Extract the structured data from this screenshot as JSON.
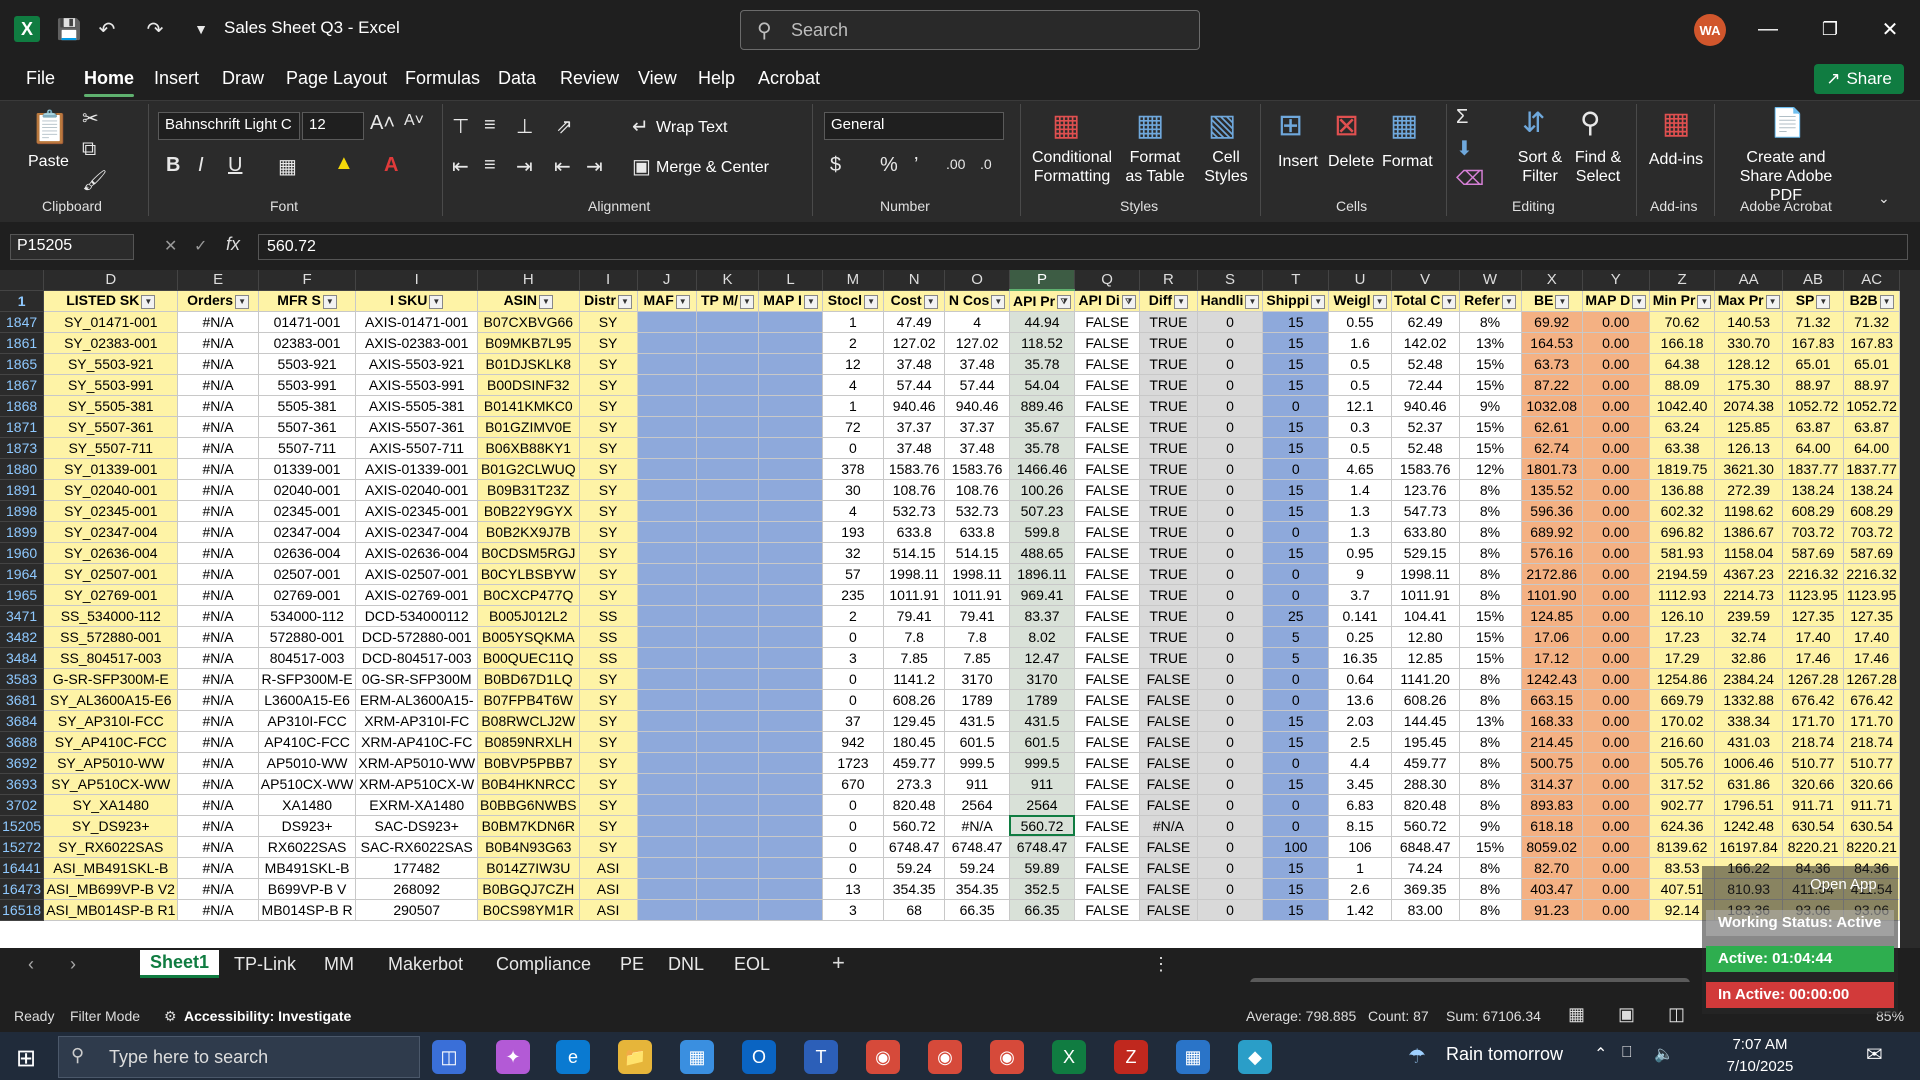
{
  "titlebar": {
    "title": "Sales Sheet Q3 - Excel",
    "search_placeholder": "Search",
    "avatar": "WA"
  },
  "menus": [
    "File",
    "Home",
    "Insert",
    "Draw",
    "Page Layout",
    "Formulas",
    "Data",
    "Review",
    "View",
    "Help",
    "Acrobat"
  ],
  "share_label": "Share",
  "ribbon": {
    "paste": "Paste",
    "clipboard": "Clipboard",
    "font_name": "Bahnschrift Light C",
    "font_size": "12",
    "font": "Font",
    "wrap_text": "Wrap Text",
    "merge_center": "Merge & Center",
    "alignment": "Alignment",
    "number_format": "General",
    "number": "Number",
    "conditional": "Conditional Formatting",
    "format_table": "Format as Table",
    "cell_styles": "Cell Styles",
    "styles": "Styles",
    "insert": "Insert",
    "delete": "Delete",
    "format": "Format",
    "cells": "Cells",
    "sort_filter": "Sort & Filter",
    "find_select": "Find & Select",
    "editing": "Editing",
    "addins": "Add-ins",
    "addins_group": "Add-ins",
    "create_share": "Create and Share Adobe PDF",
    "adobe": "Adobe Acrobat"
  },
  "formula": {
    "namebox": "P15205",
    "value": "560.72"
  },
  "columns": [
    "D",
    "E",
    "F",
    "I",
    "H",
    "I",
    "J",
    "K",
    "L",
    "M",
    "N",
    "O",
    "P",
    "Q",
    "R",
    "S",
    "T",
    "U",
    "V",
    "W",
    "X",
    "Y",
    "Z",
    "AA",
    "AB",
    "AC"
  ],
  "headers": [
    "LISTED SK",
    "Orders",
    "MFR S",
    "I SKU",
    "ASIN",
    "Distr",
    "MAF",
    "TP M/",
    "MAP I",
    "Stocl",
    "Cost",
    "N Cos",
    "API Pr",
    "API Di",
    "Diff",
    "Handli",
    "Shippi",
    "Weigl",
    "Total C",
    "Refer",
    "BE",
    "MAP D",
    "Min Pr",
    "Max Pr",
    "SP",
    "B2B"
  ],
  "rows": [
    [
      "1847",
      "SY_01471-001",
      "#N/A",
      "01471-001",
      "AXIS-01471-001",
      "B07CXBVG66",
      "SY",
      "",
      "",
      "",
      "1",
      "47.49",
      "4",
      "44.94",
      "FALSE",
      "TRUE",
      "0",
      "15",
      "0.55",
      "62.49",
      "8%",
      "69.92",
      "0.00",
      "70.62",
      "140.53",
      "71.32",
      "71.32"
    ],
    [
      "1861",
      "SY_02383-001",
      "#N/A",
      "02383-001",
      "AXIS-02383-001",
      "B09MKB7L95",
      "SY",
      "",
      "",
      "",
      "2",
      "127.02",
      "127.02",
      "118.52",
      "FALSE",
      "TRUE",
      "0",
      "15",
      "1.6",
      "142.02",
      "13%",
      "164.53",
      "0.00",
      "166.18",
      "330.70",
      "167.83",
      "167.83"
    ],
    [
      "1865",
      "SY_5503-921",
      "#N/A",
      "5503-921",
      "AXIS-5503-921",
      "B01DJSKLK8",
      "SY",
      "",
      "",
      "",
      "12",
      "37.48",
      "37.48",
      "35.78",
      "FALSE",
      "TRUE",
      "0",
      "15",
      "0.5",
      "52.48",
      "15%",
      "63.73",
      "0.00",
      "64.38",
      "128.12",
      "65.01",
      "65.01"
    ],
    [
      "1867",
      "SY_5503-991",
      "#N/A",
      "5503-991",
      "AXIS-5503-991",
      "B00DSINF32",
      "SY",
      "",
      "",
      "",
      "4",
      "57.44",
      "57.44",
      "54.04",
      "FALSE",
      "TRUE",
      "0",
      "15",
      "0.5",
      "72.44",
      "15%",
      "87.22",
      "0.00",
      "88.09",
      "175.30",
      "88.97",
      "88.97"
    ],
    [
      "1868",
      "SY_5505-381",
      "#N/A",
      "5505-381",
      "AXIS-5505-381",
      "B0141KMKC0",
      "SY",
      "",
      "",
      "",
      "1",
      "940.46",
      "940.46",
      "889.46",
      "FALSE",
      "TRUE",
      "0",
      "0",
      "12.1",
      "940.46",
      "9%",
      "1032.08",
      "0.00",
      "1042.40",
      "2074.38",
      "1052.72",
      "1052.72"
    ],
    [
      "1871",
      "SY_5507-361",
      "#N/A",
      "5507-361",
      "AXIS-5507-361",
      "B01GZIMV0E",
      "SY",
      "",
      "",
      "",
      "72",
      "37.37",
      "37.37",
      "35.67",
      "FALSE",
      "TRUE",
      "0",
      "15",
      "0.3",
      "52.37",
      "15%",
      "62.61",
      "0.00",
      "63.24",
      "125.85",
      "63.87",
      "63.87"
    ],
    [
      "1873",
      "SY_5507-711",
      "#N/A",
      "5507-711",
      "AXIS-5507-711",
      "B06XB88KY1",
      "SY",
      "",
      "",
      "",
      "0",
      "37.48",
      "37.48",
      "35.78",
      "FALSE",
      "TRUE",
      "0",
      "15",
      "0.5",
      "52.48",
      "15%",
      "62.74",
      "0.00",
      "63.38",
      "126.13",
      "64.00",
      "64.00"
    ],
    [
      "1880",
      "SY_01339-001",
      "#N/A",
      "01339-001",
      "AXIS-01339-001",
      "B01G2CLWUQ",
      "SY",
      "",
      "",
      "",
      "378",
      "1583.76",
      "1583.76",
      "1466.46",
      "FALSE",
      "TRUE",
      "0",
      "0",
      "4.65",
      "1583.76",
      "12%",
      "1801.73",
      "0.00",
      "1819.75",
      "3621.30",
      "1837.77",
      "1837.77"
    ],
    [
      "1891",
      "SY_02040-001",
      "#N/A",
      "02040-001",
      "AXIS-02040-001",
      "B09B31T23Z",
      "SY",
      "",
      "",
      "",
      "30",
      "108.76",
      "108.76",
      "100.26",
      "FALSE",
      "TRUE",
      "0",
      "15",
      "1.4",
      "123.76",
      "8%",
      "135.52",
      "0.00",
      "136.88",
      "272.39",
      "138.24",
      "138.24"
    ],
    [
      "1898",
      "SY_02345-001",
      "#N/A",
      "02345-001",
      "AXIS-02345-001",
      "B0B22Y9GYX",
      "SY",
      "",
      "",
      "",
      "4",
      "532.73",
      "532.73",
      "507.23",
      "FALSE",
      "TRUE",
      "0",
      "15",
      "1.3",
      "547.73",
      "8%",
      "596.36",
      "0.00",
      "602.32",
      "1198.62",
      "608.29",
      "608.29"
    ],
    [
      "1899",
      "SY_02347-004",
      "#N/A",
      "02347-004",
      "AXIS-02347-004",
      "B0B2KX9J7B",
      "SY",
      "",
      "",
      "",
      "193",
      "633.8",
      "633.8",
      "599.8",
      "FALSE",
      "TRUE",
      "0",
      "0",
      "1.3",
      "633.80",
      "8%",
      "689.92",
      "0.00",
      "696.82",
      "1386.67",
      "703.72",
      "703.72"
    ],
    [
      "1960",
      "SY_02636-004",
      "#N/A",
      "02636-004",
      "AXIS-02636-004",
      "B0CDSM5RGJ",
      "SY",
      "",
      "",
      "",
      "32",
      "514.15",
      "514.15",
      "488.65",
      "FALSE",
      "TRUE",
      "0",
      "15",
      "0.95",
      "529.15",
      "8%",
      "576.16",
      "0.00",
      "581.93",
      "1158.04",
      "587.69",
      "587.69"
    ],
    [
      "1964",
      "SY_02507-001",
      "#N/A",
      "02507-001",
      "AXIS-02507-001",
      "B0CYLBSBYW",
      "SY",
      "",
      "",
      "",
      "57",
      "1998.11",
      "1998.11",
      "1896.11",
      "FALSE",
      "TRUE",
      "0",
      "0",
      "9",
      "1998.11",
      "8%",
      "2172.86",
      "0.00",
      "2194.59",
      "4367.23",
      "2216.32",
      "2216.32"
    ],
    [
      "1965",
      "SY_02769-001",
      "#N/A",
      "02769-001",
      "AXIS-02769-001",
      "B0CXCP477Q",
      "SY",
      "",
      "",
      "",
      "235",
      "1011.91",
      "1011.91",
      "969.41",
      "FALSE",
      "TRUE",
      "0",
      "0",
      "3.7",
      "1011.91",
      "8%",
      "1101.90",
      "0.00",
      "1112.93",
      "2214.73",
      "1123.95",
      "1123.95"
    ],
    [
      "3471",
      "SS_534000-112",
      "#N/A",
      "534000-112",
      "DCD-534000112",
      "B005J012L2",
      "SS",
      "",
      "",
      "",
      "2",
      "79.41",
      "79.41",
      "83.37",
      "FALSE",
      "TRUE",
      "0",
      "25",
      "0.141",
      "104.41",
      "15%",
      "124.85",
      "0.00",
      "126.10",
      "239.59",
      "127.35",
      "127.35"
    ],
    [
      "3482",
      "SS_572880-001",
      "#N/A",
      "572880-001",
      "DCD-572880-001",
      "B005YSQKMA",
      "SS",
      "",
      "",
      "",
      "0",
      "7.8",
      "7.8",
      "8.02",
      "FALSE",
      "TRUE",
      "0",
      "5",
      "0.25",
      "12.80",
      "15%",
      "17.06",
      "0.00",
      "17.23",
      "32.74",
      "17.40",
      "17.40"
    ],
    [
      "3484",
      "SS_804517-003",
      "#N/A",
      "804517-003",
      "DCD-804517-003",
      "B00QUEC11Q",
      "SS",
      "",
      "",
      "",
      "3",
      "7.85",
      "7.85",
      "12.47",
      "FALSE",
      "TRUE",
      "0",
      "5",
      "16.35",
      "12.85",
      "15%",
      "17.12",
      "0.00",
      "17.29",
      "32.86",
      "17.46",
      "17.46"
    ],
    [
      "3583",
      "G-SR-SFP300M-E",
      "#N/A",
      "R-SFP300M-E",
      "0G-SR-SFP300M",
      "B0BD67D1LQ",
      "SY",
      "",
      "",
      "",
      "0",
      "1141.2",
      "3170",
      "3170",
      "FALSE",
      "FALSE",
      "0",
      "0",
      "0.64",
      "1141.20",
      "8%",
      "1242.43",
      "0.00",
      "1254.86",
      "2384.24",
      "1267.28",
      "1267.28"
    ],
    [
      "3681",
      "SY_AL3600A15-E6",
      "#N/A",
      "L3600A15-E6",
      "ERM-AL3600A15-",
      "B07FPB4T6W",
      "SY",
      "",
      "",
      "",
      "0",
      "608.26",
      "1789",
      "1789",
      "FALSE",
      "FALSE",
      "0",
      "0",
      "13.6",
      "608.26",
      "8%",
      "663.15",
      "0.00",
      "669.79",
      "1332.88",
      "676.42",
      "676.42"
    ],
    [
      "3684",
      "SY_AP310I-FCC",
      "#N/A",
      "AP310I-FCC",
      "XRM-AP310I-FC",
      "B08RWCLJ2W",
      "SY",
      "",
      "",
      "",
      "37",
      "129.45",
      "431.5",
      "431.5",
      "FALSE",
      "FALSE",
      "0",
      "15",
      "2.03",
      "144.45",
      "13%",
      "168.33",
      "0.00",
      "170.02",
      "338.34",
      "171.70",
      "171.70"
    ],
    [
      "3688",
      "SY_AP410C-FCC",
      "#N/A",
      "AP410C-FCC",
      "XRM-AP410C-FC",
      "B0859NRXLH",
      "SY",
      "",
      "",
      "",
      "942",
      "180.45",
      "601.5",
      "601.5",
      "FALSE",
      "FALSE",
      "0",
      "15",
      "2.5",
      "195.45",
      "8%",
      "214.45",
      "0.00",
      "216.60",
      "431.03",
      "218.74",
      "218.74"
    ],
    [
      "3692",
      "SY_AP5010-WW",
      "#N/A",
      "AP5010-WW",
      "XRM-AP5010-WW",
      "B0BVP5PBB7",
      "SY",
      "",
      "",
      "",
      "1723",
      "459.77",
      "999.5",
      "999.5",
      "FALSE",
      "FALSE",
      "0",
      "0",
      "4.4",
      "459.77",
      "8%",
      "500.75",
      "0.00",
      "505.76",
      "1006.46",
      "510.77",
      "510.77"
    ],
    [
      "3693",
      "SY_AP510CX-WW",
      "#N/A",
      "AP510CX-WW",
      "XRM-AP510CX-W",
      "B0B4HKNRCC",
      "SY",
      "",
      "",
      "",
      "670",
      "273.3",
      "911",
      "911",
      "FALSE",
      "FALSE",
      "0",
      "15",
      "3.45",
      "288.30",
      "8%",
      "314.37",
      "0.00",
      "317.52",
      "631.86",
      "320.66",
      "320.66"
    ],
    [
      "3702",
      "SY_XA1480",
      "#N/A",
      "XA1480",
      "EXRM-XA1480",
      "B0BBG6NWBS",
      "SY",
      "",
      "",
      "",
      "0",
      "820.48",
      "2564",
      "2564",
      "FALSE",
      "FALSE",
      "0",
      "0",
      "6.83",
      "820.48",
      "8%",
      "893.83",
      "0.00",
      "902.77",
      "1796.51",
      "911.71",
      "911.71"
    ],
    [
      "15205",
      "SY_DS923+",
      "#N/A",
      "DS923+",
      "SAC-DS923+",
      "B0BM7KDN6R",
      "SY",
      "",
      "",
      "",
      "0",
      "560.72",
      "#N/A",
      "560.72",
      "FALSE",
      "#N/A",
      "0",
      "0",
      "8.15",
      "560.72",
      "9%",
      "618.18",
      "0.00",
      "624.36",
      "1242.48",
      "630.54",
      "630.54"
    ],
    [
      "15272",
      "SY_RX6022SAS",
      "#N/A",
      "RX6022SAS",
      "SAC-RX6022SAS",
      "B0B4N93G63",
      "SY",
      "",
      "",
      "",
      "0",
      "6748.47",
      "6748.47",
      "6748.47",
      "FALSE",
      "FALSE",
      "0",
      "100",
      "106",
      "6848.47",
      "15%",
      "8059.02",
      "0.00",
      "8139.62",
      "16197.84",
      "8220.21",
      "8220.21"
    ],
    [
      "16441",
      "ASI_MB491SKL-B",
      "#N/A",
      "MB491SKL-B",
      "177482",
      "B014Z7IW3U",
      "ASI",
      "",
      "",
      "",
      "0",
      "59.24",
      "59.24",
      "59.89",
      "FALSE",
      "FALSE",
      "0",
      "15",
      "1",
      "74.24",
      "8%",
      "82.70",
      "0.00",
      "83.53",
      "166.22",
      "84.36",
      "84.36"
    ],
    [
      "16473",
      "ASI_MB699VP-B V2",
      "#N/A",
      "B699VP-B V",
      "268092",
      "B0BGQJ7CZH",
      "ASI",
      "",
      "",
      "",
      "13",
      "354.35",
      "354.35",
      "352.5",
      "FALSE",
      "FALSE",
      "0",
      "15",
      "2.6",
      "369.35",
      "8%",
      "403.47",
      "0.00",
      "407.51",
      "810.93",
      "411.54",
      "411.54"
    ],
    [
      "16518",
      "ASI_MB014SP-B R1",
      "#N/A",
      "MB014SP-B R",
      "290507",
      "B0CS98YM1R",
      "ASI",
      "",
      "",
      "",
      "3",
      "68",
      "66.35",
      "66.35",
      "FALSE",
      "FALSE",
      "0",
      "15",
      "1.42",
      "83.00",
      "8%",
      "91.23",
      "0.00",
      "92.14",
      "183.36",
      "93.06",
      "93.06"
    ]
  ],
  "sheet_tabs": [
    "Sheet1",
    "TP-Link",
    "MM",
    "Makerbot",
    "Compliance",
    "PE",
    "DNL",
    "EOL"
  ],
  "status": {
    "ready": "Ready",
    "filter_mode": "Filter Mode",
    "accessibility": "Accessibility: Investigate",
    "average": "Average: 798.885",
    "count": "Count: 87",
    "sum": "Sum: 67106.34",
    "zoom": "85%"
  },
  "overlay": {
    "open_app": "Open App",
    "working": "Working Status: Active",
    "active": "Active: 01:04:44",
    "inactive": "In Active: 00:00:00"
  },
  "taskbar": {
    "search_placeholder": "Type here to search",
    "weather": "Rain tomorrow",
    "time": "7:07 AM",
    "date": "7/10/2025"
  },
  "colors": {
    "excel_green": "#107c41",
    "header_yellow": "#fef3a6",
    "blue_fill": "#8ea9db",
    "orange_fill": "#f4b183"
  }
}
